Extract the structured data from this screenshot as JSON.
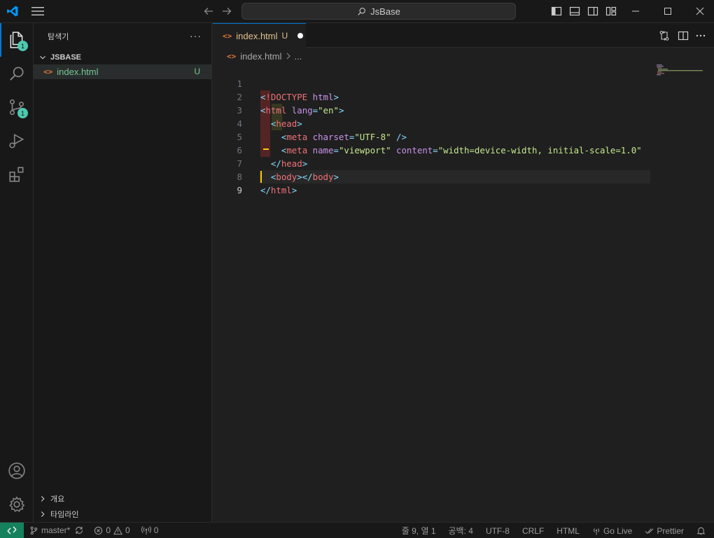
{
  "titlebar": {
    "search_text": "JsBase",
    "icons": [
      "vscode-logo",
      "menu-icon",
      "back-arrow-icon",
      "forward-arrow-icon",
      "search-icon",
      "toggle-primary-sidebar-icon",
      "toggle-panel-icon",
      "toggle-secondary-sidebar-icon",
      "customize-layout-icon",
      "minimize-icon",
      "maximize-icon",
      "close-icon"
    ]
  },
  "activity_bar": {
    "items": [
      {
        "name": "explorer",
        "badge": "1"
      },
      {
        "name": "search"
      },
      {
        "name": "source-control",
        "badge": "1"
      },
      {
        "name": "run-and-debug"
      },
      {
        "name": "extensions"
      }
    ],
    "bottom": [
      "accounts",
      "manage"
    ]
  },
  "sidebar": {
    "title": "탐색기",
    "more": "···",
    "section": "JSBASE",
    "file": {
      "name": "index.html",
      "icon": "<>",
      "status": "U"
    },
    "bottom_sections": [
      "개요",
      "타임라인"
    ]
  },
  "editor": {
    "tab": {
      "label": "index.html",
      "icon": "<>",
      "status": "U"
    },
    "breadcrumb": {
      "file": "index.html",
      "more": "..."
    },
    "line_numbers": [
      "1",
      "2",
      "3",
      "4",
      "5",
      "6",
      "7",
      "8",
      "9"
    ]
  },
  "statusbar": {
    "branch": "master*",
    "errors": "0",
    "warnings": "0",
    "ports": "0",
    "position": "줄 9, 열 1",
    "spaces": "공백: 4",
    "encoding": "UTF-8",
    "eol": "CRLF",
    "language": "HTML",
    "golive": "Go Live",
    "prettier": "Prettier"
  },
  "colors": {
    "accent": "#0078d4",
    "badge": "#4ec9b0",
    "untracked": "#73c991",
    "modified_tab": "#e2c08d",
    "remote": "#16825d"
  }
}
